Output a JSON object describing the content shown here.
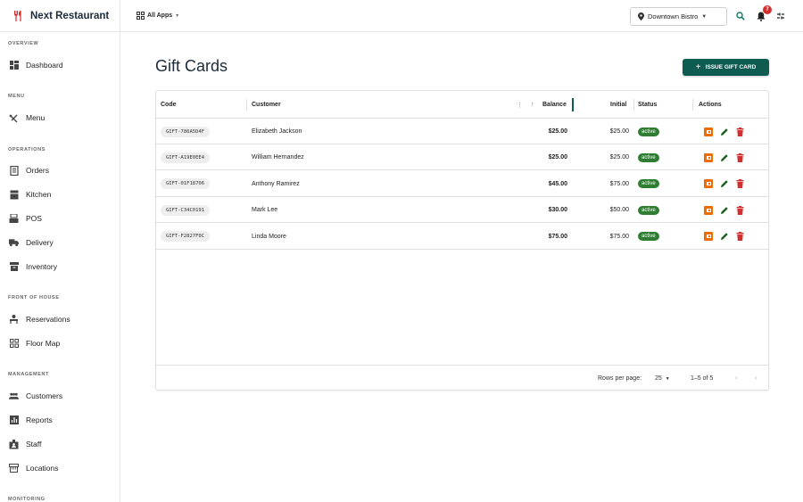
{
  "app": {
    "name": "Next Restaurant"
  },
  "topbar": {
    "apps_label": "All Apps",
    "location": "Downtown Bistro",
    "notification_count": "7"
  },
  "sidebar": {
    "sections": [
      {
        "label": "OVERVIEW"
      },
      {
        "label": "MENU"
      },
      {
        "label": "OPERATIONS"
      },
      {
        "label": "FRONT OF HOUSE"
      },
      {
        "label": "MANAGEMENT"
      },
      {
        "label": "MONITORING"
      }
    ],
    "items": [
      {
        "label": "Dashboard",
        "icon": "dashboard-icon"
      },
      {
        "label": "Menu",
        "icon": "utensils-icon"
      },
      {
        "label": "Orders",
        "icon": "receipt-icon"
      },
      {
        "label": "Kitchen",
        "icon": "kitchen-icon"
      },
      {
        "label": "POS",
        "icon": "pos-icon"
      },
      {
        "label": "Delivery",
        "icon": "truck-icon"
      },
      {
        "label": "Inventory",
        "icon": "inventory-icon"
      },
      {
        "label": "Reservations",
        "icon": "reservation-icon"
      },
      {
        "label": "Floor Map",
        "icon": "floor-map-icon"
      },
      {
        "label": "Customers",
        "icon": "people-icon"
      },
      {
        "label": "Reports",
        "icon": "chart-icon"
      },
      {
        "label": "Staff",
        "icon": "badge-icon"
      },
      {
        "label": "Locations",
        "icon": "store-icon"
      }
    ]
  },
  "page": {
    "title": "Gift Cards",
    "issue_button": "ISSUE GIFT CARD"
  },
  "table": {
    "columns": {
      "code": "Code",
      "customer": "Customer",
      "balance": "Balance",
      "initial": "Initial",
      "status": "Status",
      "actions": "Actions"
    },
    "rows": [
      {
        "code": "GIFT-786A5D4F",
        "customer": "Elizabeth Jackson",
        "balance": "$25.00",
        "initial": "$25.00",
        "status": "active"
      },
      {
        "code": "GIFT-A19E0EE4",
        "customer": "William Hernandez",
        "balance": "$25.00",
        "initial": "$25.00",
        "status": "active"
      },
      {
        "code": "GIFT-01F18706",
        "customer": "Anthony Ramirez",
        "balance": "$45.00",
        "initial": "$75.00",
        "status": "active"
      },
      {
        "code": "GIFT-C34C0191",
        "customer": "Mark Lee",
        "balance": "$30.00",
        "initial": "$50.00",
        "status": "active"
      },
      {
        "code": "GIFT-F2827F0C",
        "customer": "Linda Moore",
        "balance": "$75.00",
        "initial": "$75.00",
        "status": "active"
      }
    ],
    "footer": {
      "rows_per_page_label": "Rows per page:",
      "rows_per_page": "25",
      "range": "1–5 of 5"
    }
  },
  "colors": {
    "primary": "#0e5b52",
    "status_active": "#2e7d32",
    "redeem": "#ef6c00",
    "edit": "#1b5e20",
    "delete": "#d32f2f",
    "search": "#0e7a6a"
  }
}
